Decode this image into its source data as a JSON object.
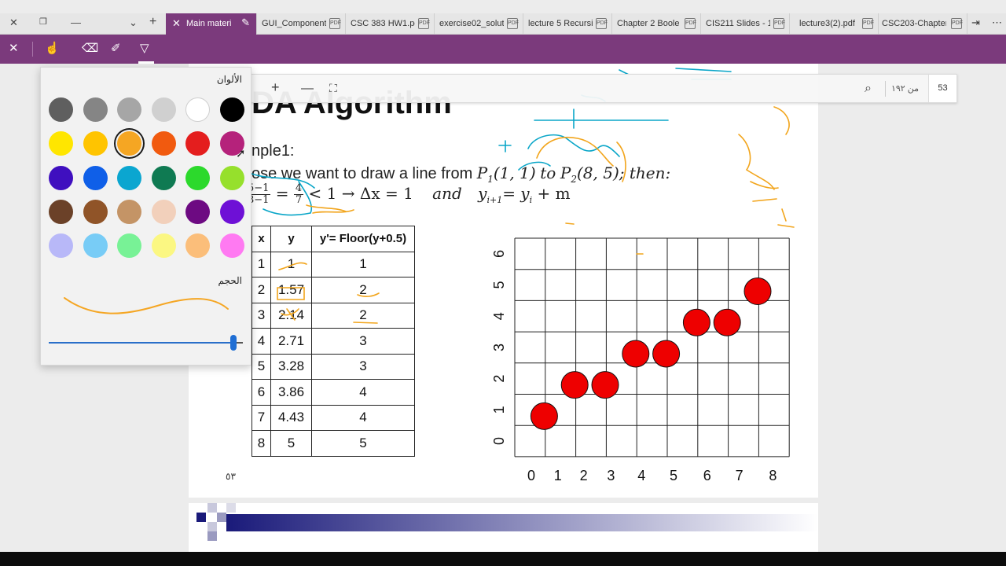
{
  "window": {
    "tabs_menu_glyph": "⌄",
    "new_tab_glyph": "+",
    "active_tab": {
      "label": "Main materi"
    },
    "tabs": [
      {
        "label": "GUI_Component"
      },
      {
        "label": "CSC 383 HW1.pc"
      },
      {
        "label": "exercise02_solut"
      },
      {
        "label": "lecture 5 Recursi"
      },
      {
        "label": "Chapter 2 Boole"
      },
      {
        "label": "CIS211 Slides - 1"
      },
      {
        "label": "lecture3(2).pdf"
      },
      {
        "label": "CSC203-Chapter"
      }
    ],
    "pdf_icon_text": "PDF"
  },
  "pdf_toolbar": {
    "page_number": "53",
    "of_pages": "من ١٩٢",
    "zoom_in": "+",
    "zoom_out": "—"
  },
  "color_flyout": {
    "title": "الألوان",
    "size_title": "الحجم",
    "selected_color": "#f5a623",
    "stroke_size_fraction": 0.95,
    "swatches": [
      [
        "#5f5f5f",
        "#858585",
        "#a6a6a6",
        "#d0d0d0",
        "#ffffff",
        "#000000"
      ],
      [
        "#ffe600",
        "#ffc400",
        "#f5a623",
        "#f15a0f",
        "#e41e1e",
        "#b5227b"
      ],
      [
        "#3f0fbf",
        "#0f5fe8",
        "#0ba6d0",
        "#0f7a52",
        "#2cd92c",
        "#96e02c"
      ],
      [
        "#6b4128",
        "#905428",
        "#c49466",
        "#f2d0bb",
        "#6d0a82",
        "#6e10d6"
      ],
      [
        "#b8b8f8",
        "#78ccf6",
        "#78f296",
        "#fbf782",
        "#fbbe7a",
        "#ff7af2"
      ]
    ]
  },
  "slide": {
    "heading": "DA Algorithm",
    "example_label": "nple1:",
    "line2_text": "ose we want to draw a line from ",
    "line2_p1": "P",
    "line2_p1_sub": "1",
    "line2_p1_coords": "(1, 1)",
    "line2_to": "to",
    "line2_p2": "P",
    "line2_p2_sub": "2",
    "line2_p2_coords": "(8, 5)",
    "line2_then": "; then:",
    "frac1_num": "5−1",
    "frac1_den": "8−1",
    "frac2_num": "4",
    "frac2_den": "7",
    "lt_one": " = ",
    "cmp": " < 1  ",
    "arrow": "→",
    "delta": " Δx = 1 ",
    "and_word": "and",
    "recur": " y",
    "recur_sub": "i+1",
    "recur_rhs": "= y",
    "recur_rhs_sub": "i",
    "recur_tail": " + m",
    "page_footer": "٥٣"
  },
  "table": {
    "headers": [
      "x",
      "y",
      "y'= Floor(y+0.5)"
    ],
    "rows": [
      [
        "1",
        "1",
        "1"
      ],
      [
        "2",
        "1.57",
        "2"
      ],
      [
        "3",
        "2.14",
        "2"
      ],
      [
        "4",
        "2.71",
        "3"
      ],
      [
        "5",
        "3.28",
        "3"
      ],
      [
        "6",
        "3.86",
        "4"
      ],
      [
        "7",
        "4.43",
        "4"
      ],
      [
        "8",
        "5",
        "5"
      ]
    ]
  },
  "chart_data": {
    "type": "scatter",
    "title": "",
    "xlabel": "",
    "ylabel": "",
    "x_ticks": [
      "0",
      "1",
      "2",
      "3",
      "4",
      "5",
      "6",
      "7",
      "8"
    ],
    "y_ticks": [
      "0",
      "1",
      "2",
      "3",
      "4",
      "5",
      "6"
    ],
    "xlim": [
      0,
      9
    ],
    "ylim": [
      0,
      7
    ],
    "marker_color": "#ee0000",
    "series": [
      {
        "x": [
          1,
          2,
          3,
          4,
          5,
          6,
          7,
          8
        ],
        "y": [
          1,
          2,
          2,
          3,
          3,
          4,
          4,
          5
        ]
      }
    ]
  }
}
